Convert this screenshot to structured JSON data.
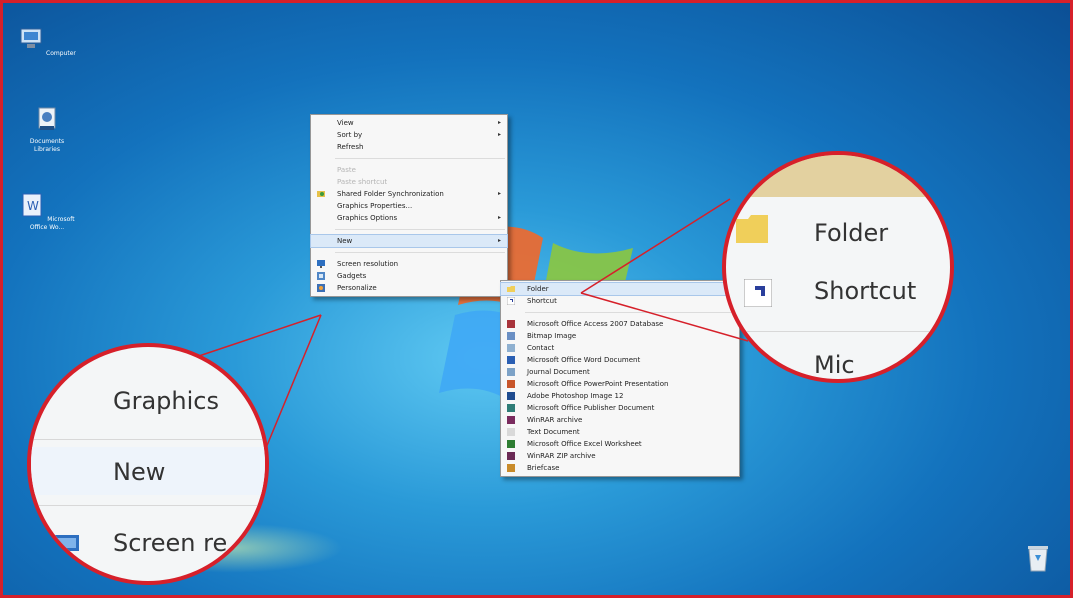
{
  "desktop": {
    "icons": [
      {
        "label": "Computer",
        "icon": "computer-icon"
      },
      {
        "label": "Documents Libraries",
        "icon": "documents-icon"
      },
      {
        "label": "Microsoft Office Wo...",
        "icon": "office-word-icon"
      }
    ],
    "recycle_bin": {
      "icon": "recycle-bin-icon"
    }
  },
  "context_menu": {
    "view": "View",
    "sort_by": "Sort by",
    "refresh": "Refresh",
    "paste": "Paste",
    "paste_shortcut": "Paste shortcut",
    "shared_folder_sync": "Shared Folder Synchronization",
    "graphics_properties": "Graphics Properties...",
    "graphics_options": "Graphics Options",
    "new": "New",
    "screen_resolution": "Screen resolution",
    "gadgets": "Gadgets",
    "personalize": "Personalize"
  },
  "new_submenu": {
    "folder": "Folder",
    "shortcut": "Shortcut",
    "items": [
      {
        "label": "Microsoft Office Access 2007 Database",
        "icon": "access-icon",
        "color": "#a8333b"
      },
      {
        "label": "Bitmap Image",
        "icon": "bitmap-icon",
        "color": "#6a8fc4"
      },
      {
        "label": "Contact",
        "icon": "contact-icon",
        "color": "#8fb0d0"
      },
      {
        "label": "Microsoft Office Word Document",
        "icon": "word-icon",
        "color": "#2b5fb3"
      },
      {
        "label": "Journal Document",
        "icon": "journal-icon",
        "color": "#7da2c7"
      },
      {
        "label": "Microsoft Office PowerPoint Presentation",
        "icon": "powerpoint-icon",
        "color": "#c8552a"
      },
      {
        "label": "Adobe Photoshop Image 12",
        "icon": "photoshop-icon",
        "color": "#1f4c8f"
      },
      {
        "label": "Microsoft Office Publisher Document",
        "icon": "publisher-icon",
        "color": "#2f7d77"
      },
      {
        "label": "WinRAR archive",
        "icon": "winrar-icon",
        "color": "#7a2b5e"
      },
      {
        "label": "Text Document",
        "icon": "text-document-icon",
        "color": "#d9d9d9"
      },
      {
        "label": "Microsoft Office Excel Worksheet",
        "icon": "excel-icon",
        "color": "#2e7d32"
      },
      {
        "label": "WinRAR ZIP archive",
        "icon": "winrar-zip-icon",
        "color": "#6b2a55"
      },
      {
        "label": "Briefcase",
        "icon": "briefcase-icon",
        "color": "#c98b2a"
      }
    ]
  },
  "zoom_left": {
    "line1": "Graphics",
    "line2": "New",
    "line3": "Screen re"
  },
  "zoom_right": {
    "line1": "Folder",
    "line2": "Shortcut",
    "line3": "Mic"
  },
  "colors": {
    "frame": "#d6202a",
    "desktop": "#1372bd"
  }
}
